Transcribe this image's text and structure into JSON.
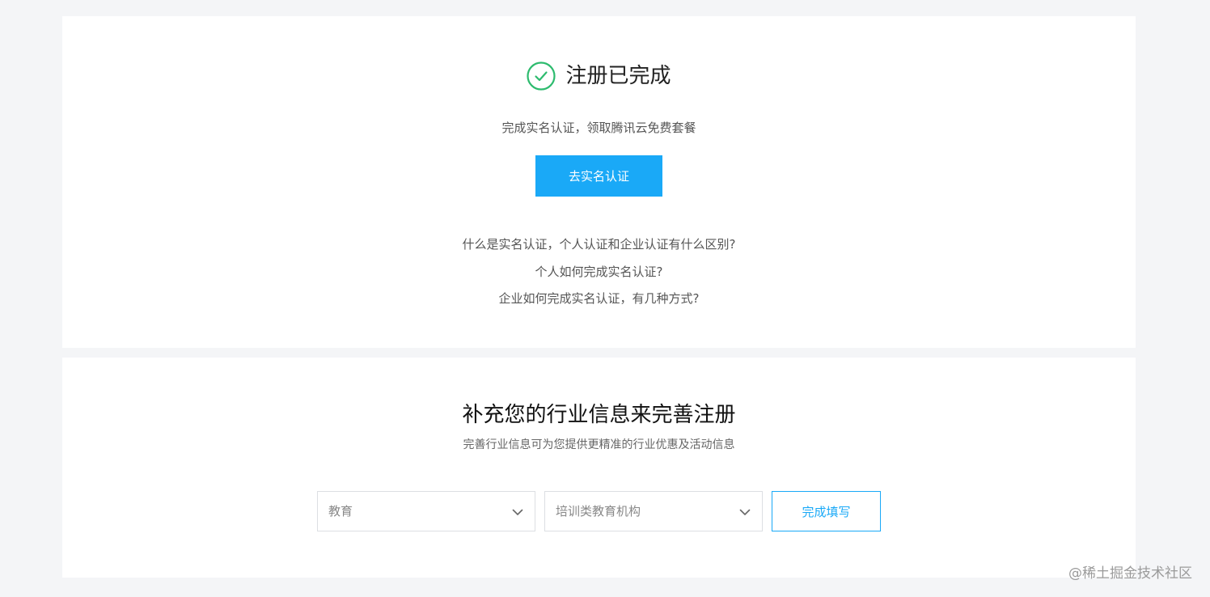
{
  "registration": {
    "title": "注册已完成",
    "subtitle": "完成实名认证，领取腾讯云免费套餐",
    "verify_button": "去实名认证",
    "faq": [
      "什么是实名认证，个人认证和企业认证有什么区别?",
      "个人如何完成实名认证?",
      "企业如何完成实名认证，有几种方式?"
    ]
  },
  "industry": {
    "title": "补充您的行业信息来完善注册",
    "subtitle": "完善行业信息可为您提供更精准的行业优惠及活动信息",
    "industry_select": "教育",
    "sub_industry_select": "培训类教育机构",
    "submit_button": "完成填写"
  },
  "watermark": "@稀土掘金技术社区",
  "colors": {
    "accent": "#1aa9f7",
    "success": "#2dbb6e",
    "page_bg": "#f4f5f7"
  },
  "icons": {
    "success": "check-circle-icon",
    "dropdown": "chevron-down-icon"
  }
}
